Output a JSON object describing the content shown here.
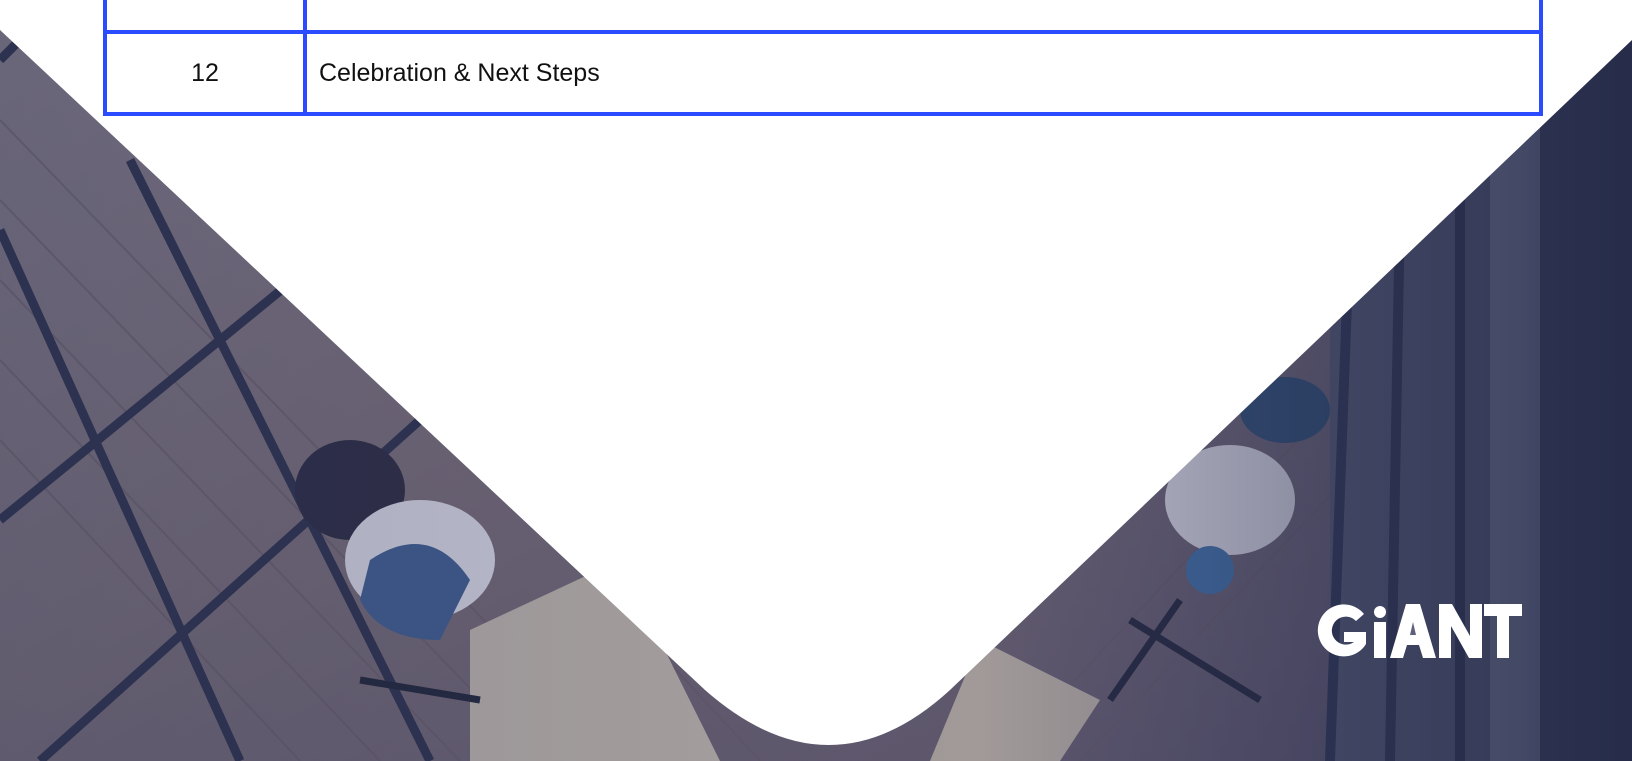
{
  "agenda": {
    "rows": [
      {
        "number": "12",
        "topic": "Celebration & Next Steps"
      }
    ]
  },
  "logo": {
    "text": "GiANT"
  },
  "colors": {
    "table_border": "#2a4bff",
    "photo_tint": "#3d4a78",
    "panel": "#ffffff"
  }
}
